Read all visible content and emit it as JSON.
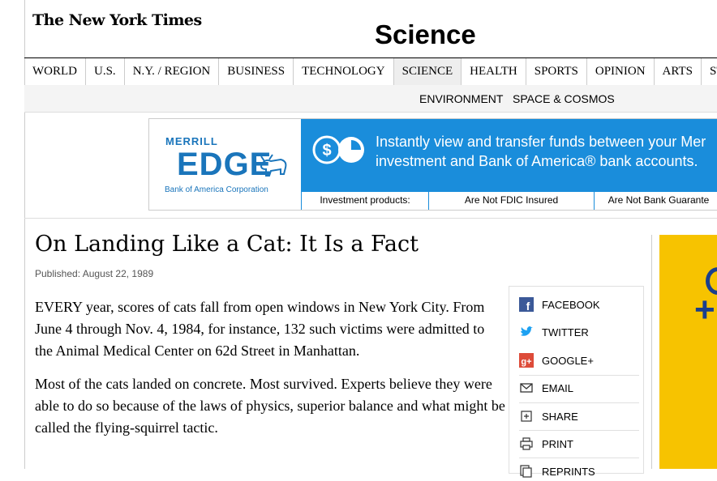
{
  "header": {
    "logo": "The New York Times",
    "section_title": "Science"
  },
  "nav": {
    "items": [
      "WORLD",
      "U.S.",
      "N.Y. / REGION",
      "BUSINESS",
      "TECHNOLOGY",
      "SCIENCE",
      "HEALTH",
      "SPORTS",
      "OPINION",
      "ARTS",
      "ST"
    ],
    "active": "SCIENCE"
  },
  "subnav": {
    "items": [
      "ENVIRONMENT",
      "SPACE & COSMOS"
    ]
  },
  "ad": {
    "brand_top": "MERRILL",
    "brand_main": "EDGE",
    "brand_sub": "Bank of America Corporation",
    "message_line1": "Instantly view and transfer funds between your Mer",
    "message_line2": "investment and Bank of America® bank accounts.",
    "disclaimers": [
      "Investment products:",
      "Are Not FDIC Insured",
      "Are Not Bank Guarante"
    ],
    "colors": {
      "brand_blue": "#1a75bb",
      "panel_blue": "#1a8ddb"
    }
  },
  "article": {
    "headline": "On Landing Like a Cat: It Is a Fact",
    "published": "Published: August 22, 1989",
    "paragraphs": [
      "EVERY year, scores of cats fall from open windows in New York City. From June 4 through Nov. 4, 1984, for instance, 132 such victims were admitted to the Animal Medical Center on 62d Street in Manhattan.",
      "Most of the cats landed on concrete. Most survived. Experts believe they were able to do so because of the laws of physics, superior balance and what might be called the flying-squirrel tactic."
    ]
  },
  "share": {
    "facebook": "FACEBOOK",
    "twitter": "TWITTER",
    "google": "GOOGLE+",
    "email": "EMAIL",
    "share": "SHARE",
    "print": "PRINT",
    "reprints": "REPRINTS"
  },
  "icons": [
    "facebook-icon",
    "twitter-icon",
    "google-plus-icon",
    "email-icon",
    "share-icon",
    "print-icon",
    "reprints-icon",
    "dollar-icon",
    "bull-icon"
  ],
  "colors": {
    "right_ad_yellow": "#f7c300",
    "right_ad_blue": "#1a3f8c"
  }
}
